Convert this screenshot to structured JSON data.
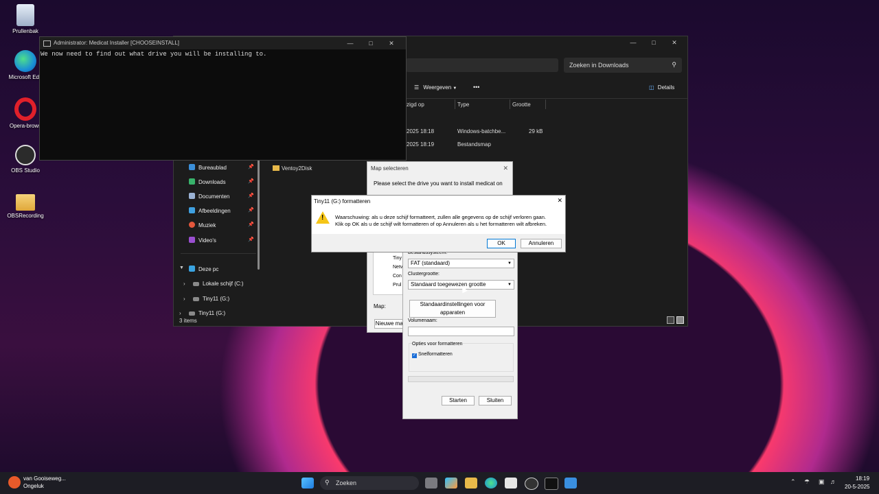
{
  "desktop_icons": [
    {
      "label": "Prullenbak",
      "icon": "recycle-bin-icon",
      "color": "#cfd8e8"
    },
    {
      "label": "Microsoft Edg",
      "icon": "edge-icon",
      "color": "#1f8fd6"
    },
    {
      "label": "Opera-brows",
      "icon": "opera-icon",
      "color": "#e0202a"
    },
    {
      "label": "OBS Studio",
      "icon": "obs-icon",
      "color": "#3a3a3a"
    },
    {
      "label": "OBSRecording",
      "icon": "folder-icon",
      "color": "#e8b94a"
    }
  ],
  "cmd": {
    "title": "Administrator:  Medicat Installer [CHOOSEINSTALL]",
    "text": "We now need to find out what drive you will be installing to."
  },
  "explorer": {
    "search_placeholder": "Zoeken in Downloads",
    "view_label": "Weergeven",
    "more_label": "•••",
    "details_label": "Details",
    "columns": [
      "zigd op",
      "Type",
      "Grootte"
    ],
    "rows": [
      {
        "date": "2025 18:18",
        "type": "Windows-batchbe...",
        "size": "29 kB"
      },
      {
        "date": "2025 18:19",
        "type": "Bestandsmap",
        "size": ""
      }
    ],
    "sidebar": [
      "Bureaublad",
      "Downloads",
      "Documenten",
      "Afbeeldingen",
      "Muziek",
      "Video's"
    ],
    "pc_label": "Deze pc",
    "drives": [
      "Lokale schijf (C:)",
      "Tiny11 (G:)",
      "Tiny11 (G:)"
    ],
    "folder_item": "Ventoy2Disk",
    "status": "3 items"
  },
  "map_dialog": {
    "title": "Map selecteren",
    "text": "Please select the drive you want to install medicat on",
    "map_label": "Map:",
    "new_folder": "Nieuwe map",
    "tree": [
      "Tiny",
      "Netv",
      "Con",
      "Prul"
    ]
  },
  "format_dialog": {
    "fs_label": "Bestandssysteem:",
    "fs_value": "FAT (standaard)",
    "cluster_label": "Clustergrootte:",
    "cluster_value": "Standaard toegewezen grootte",
    "restore_button": "Standaardinstellingen voor apparaten",
    "volume_label": "Volumenaam:",
    "options_label": "Opties voor formatteren",
    "quick_label": "Snelformatteren",
    "start_button": "Starten",
    "close_button": "Sluiten"
  },
  "warning_dialog": {
    "title": "Tiny11 (G:) formatteren",
    "line1": "Waarschuwing: als u deze schijf formatteert, zullen alle gegevens op de schijf verloren gaan.",
    "line2": "Klik op OK als u de schijf wilt formatteren of op Annuleren als u het formatteren wilt afbreken.",
    "ok": "OK",
    "cancel": "Annuleren"
  },
  "taskbar": {
    "weather_title": "van Gooiseweg...",
    "weather_sub": "Ongeluk",
    "search": "Zoeken",
    "time": "18:19",
    "date": "20-5-2025"
  }
}
